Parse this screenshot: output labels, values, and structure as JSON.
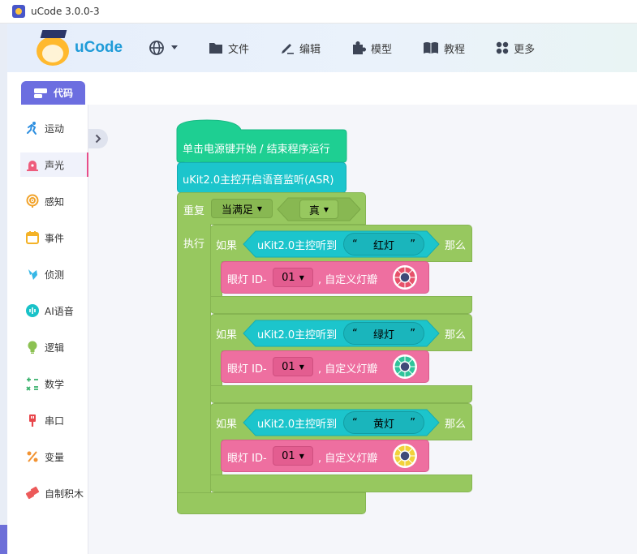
{
  "window": {
    "title": "uCode 3.0.0-3"
  },
  "header": {
    "logo_text": "uCode",
    "nav": [
      {
        "label": "文件",
        "icon": "folder-icon"
      },
      {
        "label": "编辑",
        "icon": "pen-icon"
      },
      {
        "label": "模型",
        "icon": "puzzle-icon"
      },
      {
        "label": "教程",
        "icon": "book-icon"
      },
      {
        "label": "更多",
        "icon": "grid-icon"
      }
    ]
  },
  "sidebar": {
    "code_tab": "代码",
    "categories": [
      {
        "label": "运动",
        "icon": "run-icon",
        "color": "#2e8fe0"
      },
      {
        "label": "声光",
        "icon": "siren-icon",
        "color": "#ee5d7d"
      },
      {
        "label": "感知",
        "icon": "sensor-icon",
        "color": "#f1a32b"
      },
      {
        "label": "事件",
        "icon": "calendar-icon",
        "color": "#f4b227"
      },
      {
        "label": "侦测",
        "icon": "detect-icon",
        "color": "#36b7e6"
      },
      {
        "label": "AI语音",
        "icon": "voice-icon",
        "color": "#18c2c8"
      },
      {
        "label": "逻辑",
        "icon": "bulb-icon",
        "color": "#8cc152"
      },
      {
        "label": "数学",
        "icon": "math-icon",
        "color": "#38b16b"
      },
      {
        "label": "串口",
        "icon": "serial-icon",
        "color": "#e8464b"
      },
      {
        "label": "变量",
        "icon": "variable-icon",
        "color": "#f29332"
      },
      {
        "label": "自制积木",
        "icon": "custom-block-icon",
        "color": "#ec5a5a"
      }
    ],
    "active_index": 1
  },
  "script": {
    "hat": "单击电源键开始 / 结束程序运行",
    "asr": "uKit2.0主控开启语音监听(ASR)",
    "repeat_label": "重复",
    "repeat_mode": "当满足",
    "condition_value": "真",
    "exec_label": "执行",
    "ifs": [
      {
        "if_label": "如果",
        "sensor": "uKit2.0主控听到",
        "open_quote": "“",
        "word": "红灯",
        "close_quote": "”",
        "then_label": "那么",
        "action": "眼灯 ID-",
        "id": "01",
        "suffix": ", 自定义灯瓣",
        "petal_color": "#e7516a",
        "petal_center": "#3f4a78"
      },
      {
        "if_label": "如果",
        "sensor": "uKit2.0主控听到",
        "open_quote": "“",
        "word": "绿灯",
        "close_quote": "”",
        "then_label": "那么",
        "action": "眼灯 ID-",
        "id": "01",
        "suffix": ", 自定义灯瓣",
        "petal_color": "#2fc49b",
        "petal_center": "#3f4a78"
      },
      {
        "if_label": "如果",
        "sensor": "uKit2.0主控听到",
        "open_quote": "“",
        "word": "黄灯",
        "close_quote": "”",
        "then_label": "那么",
        "action": "眼灯 ID-",
        "id": "01",
        "suffix": ", 自定义灯瓣",
        "petal_color": "#f2d23b",
        "petal_center": "#3f4a78"
      }
    ]
  },
  "colors": {
    "hat_block": "#1ecf92",
    "sensor_block": "#1cc5cc",
    "control_block": "#97c85f",
    "light_block": "#ee6fa0",
    "code_tab": "#6c6ee0"
  }
}
